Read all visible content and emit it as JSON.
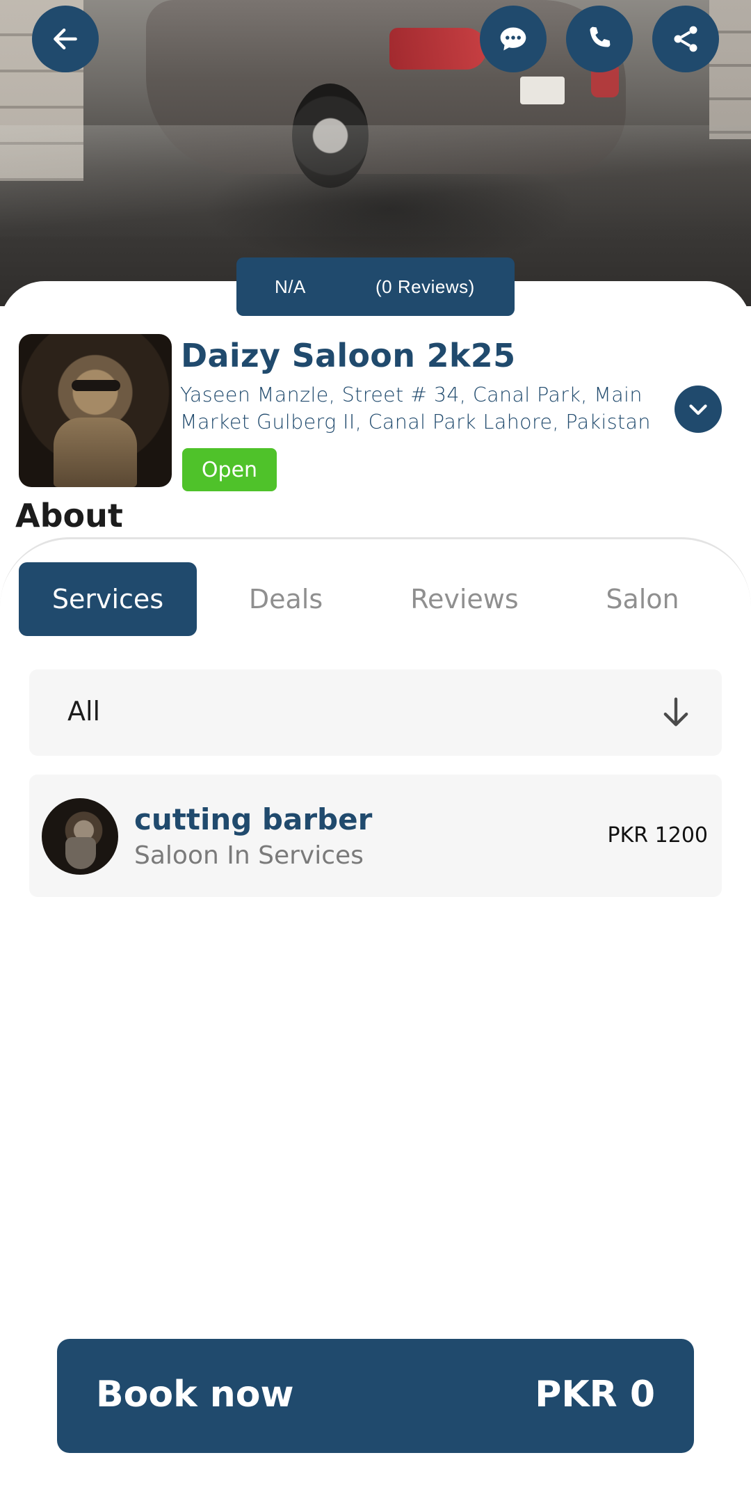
{
  "header": {
    "icons": [
      "back-arrow-icon",
      "chat-bubble-icon",
      "phone-icon",
      "share-icon"
    ]
  },
  "rating": {
    "score": "N/A",
    "reviews": "(0 Reviews)"
  },
  "salon": {
    "name": "Daizy Saloon 2k25",
    "address": "Yaseen Manzle, Street # 34, Canal Park, Main Market Gulberg II, Canal Park Lahore, Pakistan",
    "status": "Open"
  },
  "about": {
    "heading": "About"
  },
  "tabs": [
    {
      "label": "Services",
      "active": true
    },
    {
      "label": "Deals",
      "active": false
    },
    {
      "label": "Reviews",
      "active": false
    },
    {
      "label": "Salon",
      "active": false
    }
  ],
  "filter": {
    "selected": "All"
  },
  "services": [
    {
      "name": "cutting barber",
      "category": "Saloon In Services",
      "price": "PKR 1200"
    }
  ],
  "booking": {
    "button_label": "Book now",
    "total": "PKR 0"
  },
  "colors": {
    "primary": "#204a6d",
    "open_green": "#4fc22a",
    "card_bg": "#f6f6f6",
    "muted_text": "#8f8f8f"
  }
}
